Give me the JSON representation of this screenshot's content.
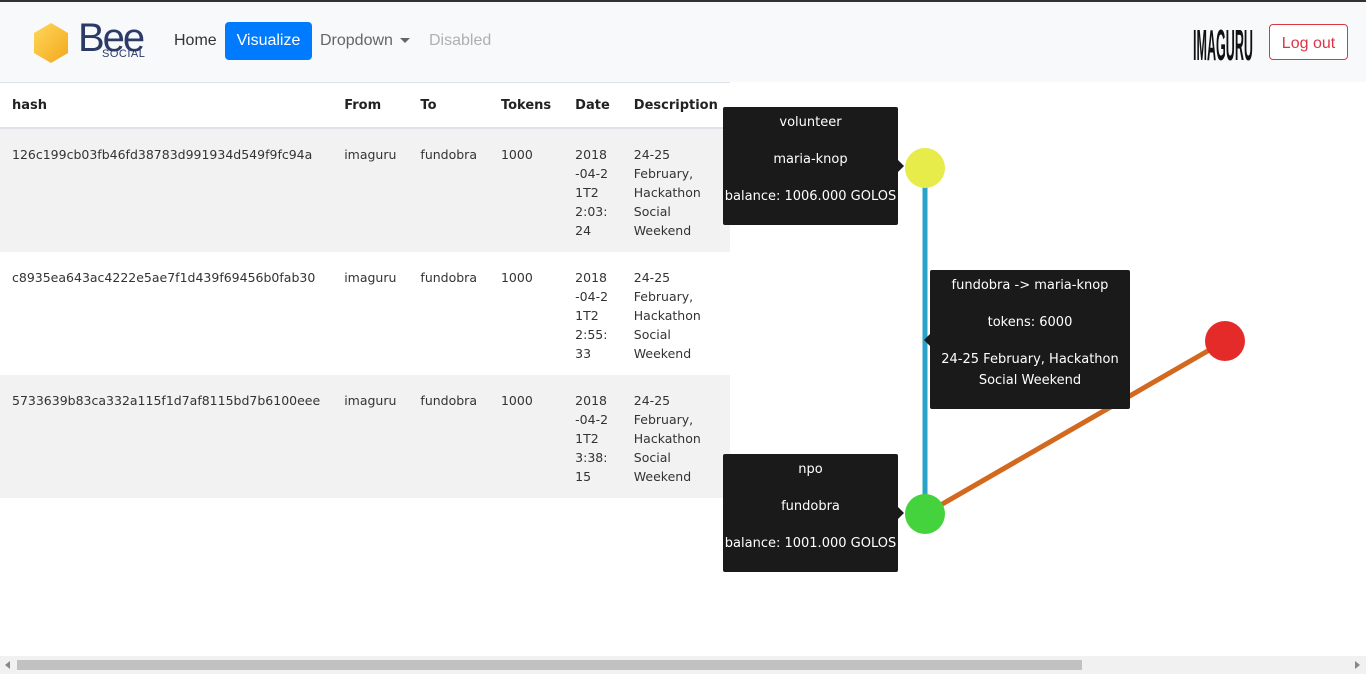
{
  "navbar": {
    "brand": {
      "name": "Bee",
      "subtitle": "SOCIAL",
      "hex_color": "#f9c12e"
    },
    "links": {
      "home": "Home",
      "visualize": "Visualize",
      "dropdown": "Dropdown",
      "disabled": "Disabled"
    },
    "user_logo_text": "IMAGURU",
    "logout": "Log out",
    "accent_color": "#007bff",
    "danger_color": "#dc3545"
  },
  "table": {
    "headers": {
      "hash": "hash",
      "from": "From",
      "to": "To",
      "tokens": "Tokens",
      "date": "Date",
      "description": "Description"
    },
    "rows": [
      {
        "hash": "126c199cb03fb46fd38783d991934d549f9fc94a",
        "from": "imaguru",
        "to": "fundobra",
        "tokens": "1000",
        "date": "2018-04-21T22:03:24",
        "description": "24-25 February, Hackathon Social Weekend"
      },
      {
        "hash": "c8935ea643ac4222e5ae7f1d439f69456b0fab30",
        "from": "imaguru",
        "to": "fundobra",
        "tokens": "1000",
        "date": "2018-04-21T22:55:33",
        "description": "24-25 February, Hackathon Social Weekend"
      },
      {
        "hash": "5733639b83ca332a115f1d7af8115bd7b6100eee",
        "from": "imaguru",
        "to": "fundobra",
        "tokens": "1000",
        "date": "2018-04-21T23:38:15",
        "description": "24-25 February, Hackathon Social Weekend"
      }
    ]
  },
  "graph": {
    "nodes": {
      "volunteer": {
        "color": "#e8ec4a"
      },
      "npo": {
        "color": "#44d33c"
      },
      "other": {
        "color": "#e52a2a"
      }
    },
    "edges": {
      "blue": {
        "color": "#2ba3c8"
      },
      "orange": {
        "color": "#d2691e"
      }
    },
    "tooltips": {
      "volunteer": {
        "role": "volunteer",
        "name": "maria-knop",
        "balance": "balance: 1006.000 GOLOS"
      },
      "npo": {
        "role": "npo",
        "name": "fundobra",
        "balance": "balance: 1001.000 GOLOS"
      },
      "edge": {
        "route": "fundobra -> maria-knop",
        "tokens": "tokens: 6000",
        "description_line1": "24-25 February, Hackathon",
        "description_line2": "Social Weekend"
      }
    }
  }
}
